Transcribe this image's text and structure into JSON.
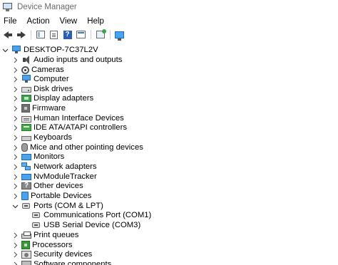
{
  "window": {
    "title": "Device Manager"
  },
  "menu": [
    "File",
    "Action",
    "View",
    "Help"
  ],
  "toolbar": {
    "buttons": [
      "back-arrow",
      "forward-arrow",
      "show-hide-console-tree",
      "properties-sheet",
      "help",
      "device-properties",
      "scan-for-hardware-changes",
      "display-monitor"
    ]
  },
  "tree": {
    "root": "DESKTOP-7C37L2V",
    "categories": [
      {
        "label": "Audio inputs and outputs",
        "icon": "speaker-icon",
        "expanded": false
      },
      {
        "label": "Cameras",
        "icon": "camera-icon",
        "expanded": false
      },
      {
        "label": "Computer",
        "icon": "computer-icon",
        "expanded": false
      },
      {
        "label": "Disk drives",
        "icon": "disk-drive-icon",
        "expanded": false
      },
      {
        "label": "Display adapters",
        "icon": "display-adapter-icon",
        "expanded": false
      },
      {
        "label": "Firmware",
        "icon": "firmware-icon",
        "expanded": false
      },
      {
        "label": "Human Interface Devices",
        "icon": "hid-icon",
        "expanded": false
      },
      {
        "label": "IDE ATA/ATAPI controllers",
        "icon": "ide-controller-icon",
        "expanded": false
      },
      {
        "label": "Keyboards",
        "icon": "keyboard-icon",
        "expanded": false
      },
      {
        "label": "Mice and other pointing devices",
        "icon": "mouse-icon",
        "expanded": false
      },
      {
        "label": "Monitors",
        "icon": "monitor-icon",
        "expanded": false
      },
      {
        "label": "Network adapters",
        "icon": "network-adapter-icon",
        "expanded": false
      },
      {
        "label": "NvModuleTracker",
        "icon": "nvmodule-icon",
        "expanded": false
      },
      {
        "label": "Other devices",
        "icon": "other-device-icon",
        "expanded": false
      },
      {
        "label": "Portable Devices",
        "icon": "portable-device-icon",
        "expanded": false
      },
      {
        "label": "Ports (COM & LPT)",
        "icon": "port-icon",
        "expanded": true,
        "children": [
          "Communications Port (COM1)",
          "USB Serial Device (COM3)"
        ]
      },
      {
        "label": "Print queues",
        "icon": "printer-icon",
        "expanded": false
      },
      {
        "label": "Processors",
        "icon": "processor-icon",
        "expanded": false
      },
      {
        "label": "Security devices",
        "icon": "security-device-icon",
        "expanded": false
      },
      {
        "label": "Software components",
        "icon": "software-component-icon",
        "expanded": false
      }
    ]
  }
}
